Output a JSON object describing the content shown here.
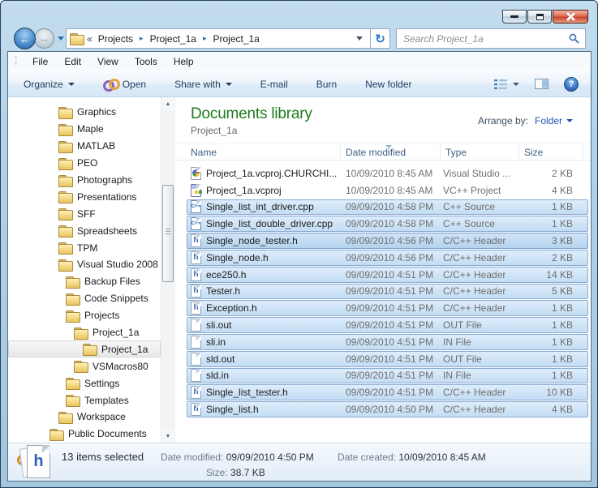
{
  "nav": {
    "breadcrumb": {
      "overflow": "«",
      "separator": "▸",
      "items": [
        "Projects",
        "Project_1a",
        "Project_1a"
      ]
    },
    "search_placeholder": "Search Project_1a",
    "back_glyph": "←",
    "forward_glyph": "→",
    "refresh_glyph": "↻"
  },
  "menu": {
    "items": [
      "File",
      "Edit",
      "View",
      "Tools",
      "Help"
    ]
  },
  "toolbar": {
    "items": [
      {
        "label": "Organize",
        "dropdown": true
      },
      {
        "label": "Open",
        "icon": "vs-logo"
      },
      {
        "label": "Share with",
        "dropdown": true
      },
      {
        "label": "E-mail"
      },
      {
        "label": "Burn"
      },
      {
        "label": "New folder"
      }
    ],
    "help_glyph": "?"
  },
  "library": {
    "title": "Documents library",
    "subtitle": "Project_1a",
    "arrange_label": "Arrange by:",
    "arrange_value": "Folder"
  },
  "columns": [
    {
      "label": "Name"
    },
    {
      "label": "Date modified",
      "sort": "desc"
    },
    {
      "label": "Type"
    },
    {
      "label": "Size"
    }
  ],
  "sidebar": {
    "items": [
      {
        "label": "Graphics",
        "level": 2
      },
      {
        "label": "Maple",
        "level": 2
      },
      {
        "label": "MATLAB",
        "level": 2
      },
      {
        "label": "PEO",
        "level": 2
      },
      {
        "label": "Photographs",
        "level": 2
      },
      {
        "label": "Presentations",
        "level": 2
      },
      {
        "label": "SFF",
        "level": 2
      },
      {
        "label": "Spreadsheets",
        "level": 2
      },
      {
        "label": "TPM",
        "level": 2
      },
      {
        "label": "Visual Studio 2008",
        "level": 2
      },
      {
        "label": "Backup Files",
        "level": 3
      },
      {
        "label": "Code Snippets",
        "level": 3
      },
      {
        "label": "Projects",
        "level": 3
      },
      {
        "label": "Project_1a",
        "level": 4
      },
      {
        "label": "Project_1a",
        "level": 5,
        "selected": true
      },
      {
        "label": "VSMacros80",
        "level": 4
      },
      {
        "label": "Settings",
        "level": 3
      },
      {
        "label": "Templates",
        "level": 3
      },
      {
        "label": "Workspace",
        "level": 2
      },
      {
        "label": "Public Documents",
        "level": 1
      }
    ]
  },
  "files": [
    {
      "name": "Project_1a.vcproj.CHURCHI...",
      "icon": "vsuser",
      "date": "10/09/2010 8:45 AM",
      "type": "Visual Studio ...",
      "size": "2 KB",
      "selected": false
    },
    {
      "name": "Project_1a.vcproj",
      "icon": "vcproj",
      "date": "10/09/2010 8:45 AM",
      "type": "VC++ Project",
      "size": "4 KB",
      "selected": false
    },
    {
      "name": "Single_list_int_driver.cpp",
      "icon": "cpp",
      "date": "09/09/2010 4:58 PM",
      "type": "C++ Source",
      "size": "1 KB",
      "selected": true
    },
    {
      "name": "Single_list_double_driver.cpp",
      "icon": "cpp",
      "date": "09/09/2010 4:58 PM",
      "type": "C++ Source",
      "size": "1 KB",
      "selected": true
    },
    {
      "name": "Single_node_tester.h",
      "icon": "h",
      "date": "09/09/2010 4:56 PM",
      "type": "C/C++ Header",
      "size": "3 KB",
      "selected": true,
      "focused": true
    },
    {
      "name": "Single_node.h",
      "icon": "h",
      "date": "09/09/2010 4:56 PM",
      "type": "C/C++ Header",
      "size": "2 KB",
      "selected": true
    },
    {
      "name": "ece250.h",
      "icon": "h",
      "date": "09/09/2010 4:51 PM",
      "type": "C/C++ Header",
      "size": "14 KB",
      "selected": true
    },
    {
      "name": "Tester.h",
      "icon": "h",
      "date": "09/09/2010 4:51 PM",
      "type": "C/C++ Header",
      "size": "5 KB",
      "selected": true
    },
    {
      "name": "Exception.h",
      "icon": "h",
      "date": "09/09/2010 4:51 PM",
      "type": "C/C++ Header",
      "size": "1 KB",
      "selected": true
    },
    {
      "name": "sli.out",
      "icon": "blank",
      "date": "09/09/2010 4:51 PM",
      "type": "OUT File",
      "size": "1 KB",
      "selected": true
    },
    {
      "name": "sli.in",
      "icon": "blank",
      "date": "09/09/2010 4:51 PM",
      "type": "IN File",
      "size": "1 KB",
      "selected": true
    },
    {
      "name": "sld.out",
      "icon": "blank",
      "date": "09/09/2010 4:51 PM",
      "type": "OUT File",
      "size": "1 KB",
      "selected": true
    },
    {
      "name": "sld.in",
      "icon": "blank",
      "date": "09/09/2010 4:51 PM",
      "type": "IN File",
      "size": "1 KB",
      "selected": true
    },
    {
      "name": "Single_list_tester.h",
      "icon": "h",
      "date": "09/09/2010 4:51 PM",
      "type": "C/C++ Header",
      "size": "10 KB",
      "selected": true
    },
    {
      "name": "Single_list.h",
      "icon": "h",
      "date": "09/09/2010 4:50 PM",
      "type": "C/C++ Header",
      "size": "4 KB",
      "selected": true
    }
  ],
  "icon_glyphs": {
    "h": "h",
    "cpp": "C++"
  },
  "details": {
    "icon_glyph": "h",
    "selection_count": "13 items selected",
    "labels": {
      "date_modified": "Date modified: ",
      "size": "Size: ",
      "date_created": "Date created: "
    },
    "date_modified": "09/09/2010 4:50 PM",
    "size": "38.7 KB",
    "date_created": "10/09/2010 8:45 AM"
  }
}
